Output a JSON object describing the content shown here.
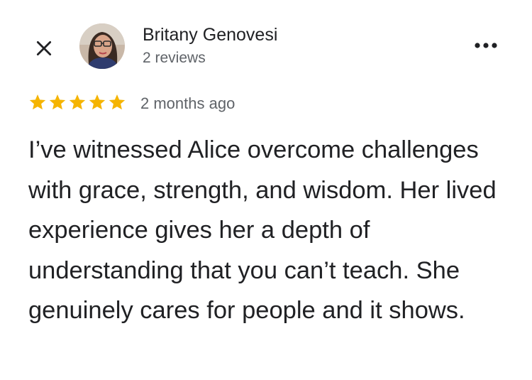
{
  "review": {
    "reviewer_name": "Britany Genovesi",
    "review_count": "2 reviews",
    "rating": 5,
    "rating_max": 5,
    "date": "2 months ago",
    "text": "I’ve witnessed Alice overcome challenges with grace, strength, and wisdom. Her lived experience gives her a depth of understanding that you can’t teach. She genuinely cares for people and it shows."
  },
  "icons": {
    "close": "close-icon",
    "more": "more-options-icon",
    "star": "star-icon"
  },
  "colors": {
    "star": "#f5b400",
    "text_primary": "#202124",
    "text_secondary": "#5f6368"
  }
}
